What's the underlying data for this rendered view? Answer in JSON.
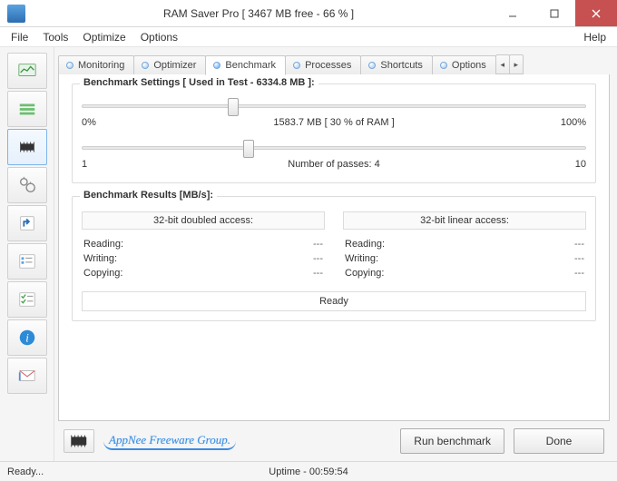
{
  "window": {
    "title": "RAM Saver Pro [ 3467 MB free - 66 % ]"
  },
  "menu": {
    "file": "File",
    "tools": "Tools",
    "optimize": "Optimize",
    "options": "Options",
    "help": "Help"
  },
  "tabs": {
    "monitoring": "Monitoring",
    "optimizer": "Optimizer",
    "benchmark": "Benchmark",
    "processes": "Processes",
    "shortcuts": "Shortcuts",
    "options": "Options"
  },
  "benchmark": {
    "settings_title": "Benchmark Settings [ Used in Test - 6334.8 MB ]:",
    "slider1": {
      "left": "0%",
      "mid": "1583.7 MB [ 30 % of RAM ]",
      "right": "100%",
      "pos_pct": 30
    },
    "slider2": {
      "left": "1",
      "mid": "Number of passes: 4",
      "right": "10",
      "pos_pct": 33
    },
    "results_title": "Benchmark Results [MB/s]:",
    "col1_header": "32-bit doubled access:",
    "col2_header": "32-bit linear access:",
    "rows": {
      "reading": "Reading:",
      "writing": "Writing:",
      "copying": "Copying:",
      "dash": "---"
    },
    "ready": "Ready"
  },
  "buttons": {
    "run": "Run benchmark",
    "done": "Done"
  },
  "watermark": "AppNee Freeware Group.",
  "status": {
    "left": "Ready...",
    "uptime": "Uptime - 00:59:54"
  }
}
